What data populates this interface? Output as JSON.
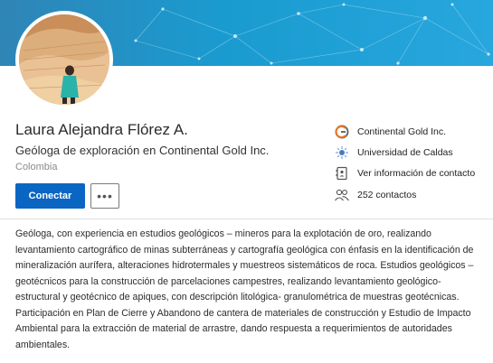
{
  "profile": {
    "name": "Laura Alejandra Flórez A.",
    "headline": "Geóloga de exploración en Continental Gold Inc.",
    "location": "Colombia"
  },
  "actions": {
    "connect_label": "Conectar",
    "more_label": "•••"
  },
  "sidebar": {
    "items": [
      {
        "label": "Continental Gold Inc.",
        "icon": "company-logo-icon"
      },
      {
        "label": "Universidad de Caldas",
        "icon": "university-logo-icon"
      },
      {
        "label": "Ver información de contacto",
        "icon": "contact-card-icon"
      },
      {
        "label": "252 contactos",
        "icon": "people-icon"
      }
    ]
  },
  "about": {
    "text": "Geóloga, con experiencia en estudios geológicos – mineros para la explotación de oro, realizando levantamiento cartográfico de minas subterráneas y cartografía geológica con énfasis en la identificación de mineralización aurífera, alteraciones hidrotermales y muestreos sistemáticos de roca. Estudios geológicos – geotécnicos para la construcción de parcelaciones campestres, realizando levantamiento geológico-estructural y geotécnico de apiques, con descripción litológica- granulométrica de muestras geotécnicas. Participación en Plan de Cierre y Abandono de cantera de materiales de construcción y Estudio de Impacto Ambiental para la extracción de material de arrastre, dando respuesta a requerimientos de autoridades ambientales."
  },
  "colors": {
    "accent": "#0a66c2",
    "banner": "#1a9bd0"
  }
}
